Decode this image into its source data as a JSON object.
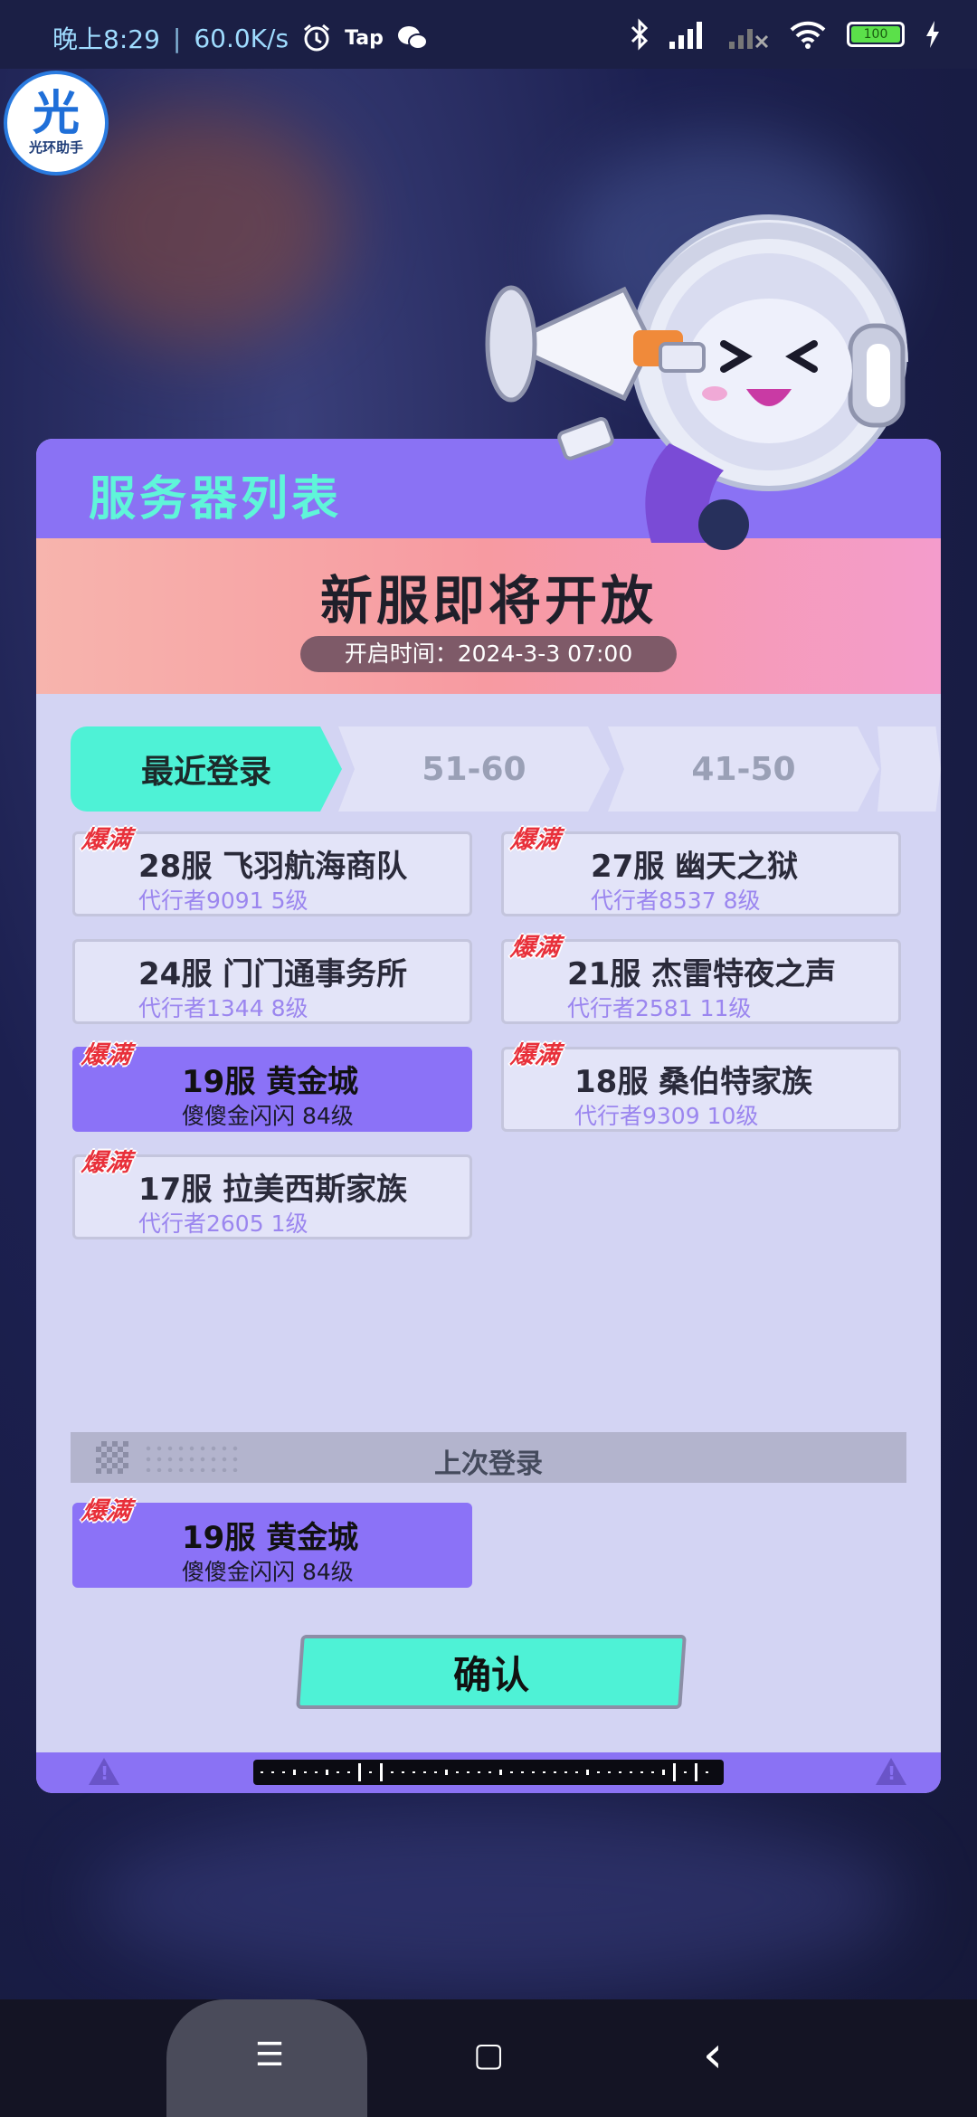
{
  "status_bar": {
    "time": "晚上8:29",
    "separator": "|",
    "speed": "60.0K/s",
    "tap_label": "Tap",
    "battery": "100",
    "icons": [
      "alarm-icon",
      "tap-icon",
      "wechat-icon",
      "bluetooth-icon",
      "signal-icon",
      "signal-off-icon",
      "wifi-icon",
      "battery-icon",
      "charging-icon"
    ]
  },
  "overlay_logo": {
    "main": "光",
    "sub": "光环助手"
  },
  "panel": {
    "title": "服务器列表",
    "banner": {
      "title": "新服即将开放",
      "open_time": "开启时间：2024-3-3 07:00"
    },
    "tabs": [
      {
        "label": "最近登录",
        "active": true
      },
      {
        "label": "51-60",
        "active": false
      },
      {
        "label": "41-50",
        "active": false
      },
      {
        "label": "",
        "active": false
      }
    ],
    "badge_text": "爆满",
    "servers": [
      {
        "name": "28服 飞羽航海商队",
        "sub": "代行者9091 5级",
        "badge": true,
        "selected": false
      },
      {
        "name": "27服 幽天之狱",
        "sub": "代行者8537 8级",
        "badge": true,
        "selected": false
      },
      {
        "name": "24服 门门通事务所",
        "sub": "代行者1344 8级",
        "badge": false,
        "selected": false
      },
      {
        "name": "21服 杰雷特夜之声",
        "sub": "代行者2581 11级",
        "badge": true,
        "selected": false
      },
      {
        "name": "19服 黄金城",
        "sub": "傻傻金闪闪 84级",
        "badge": true,
        "selected": true
      },
      {
        "name": "18服 桑伯特家族",
        "sub": "代行者9309 10级",
        "badge": true,
        "selected": false
      },
      {
        "name": "17服 拉美西斯家族",
        "sub": "代行者2605 1级",
        "badge": true,
        "selected": false
      }
    ],
    "last_login": {
      "label": "上次登录",
      "server": {
        "name": "19服 黄金城",
        "sub": "傻傻金闪闪 84级",
        "badge": true,
        "selected": true
      }
    },
    "confirm_label": "确认"
  },
  "nav_bar": {
    "menu_icon": "☰",
    "home_icon": "▢",
    "back_icon": "‹"
  },
  "colors": {
    "panel_bg": "#d3d4f3",
    "header_purple": "#8a72f4",
    "accent_teal": "#4ef2d6",
    "badge_red": "#e8303a",
    "selected_purple": "#8b72f7"
  }
}
